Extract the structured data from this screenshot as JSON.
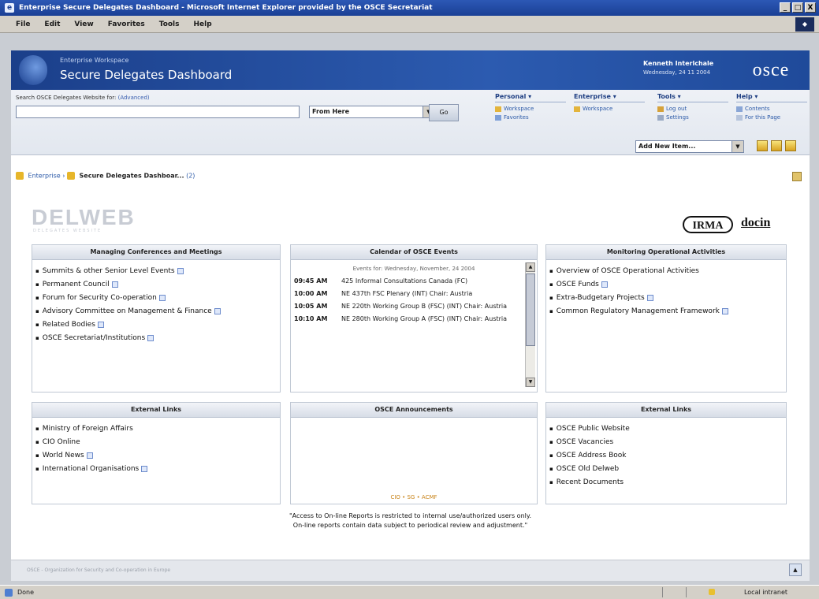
{
  "window": {
    "title": "Enterprise Secure Delegates Dashboard - Microsoft Internet Explorer provided by the OSCE Secretariat",
    "buttons": [
      "_",
      "□",
      "X"
    ]
  },
  "menubar": [
    "File",
    "Edit",
    "View",
    "Favorites",
    "Tools",
    "Help"
  ],
  "banner": {
    "subtitle": "Enterprise Workspace",
    "title": "Secure Delegates Dashboard",
    "user": "Kenneth Interlchale",
    "date": "Wednesday, 24 11 2004",
    "logo": "osce"
  },
  "search": {
    "label": "Search OSCE Delegates Website for:",
    "advanced": "(Advanced)",
    "value": "",
    "scope": "From Here",
    "go": "Go"
  },
  "nav": [
    {
      "heading": "Personal ▾",
      "links": [
        "Workspace",
        "Favorites"
      ]
    },
    {
      "heading": "Enterprise ▾",
      "links": [
        "Workspace"
      ]
    },
    {
      "heading": "Tools ▾",
      "links": [
        "Log out",
        "Settings"
      ]
    },
    {
      "heading": "Help ▾",
      "links": [
        "Contents",
        "For this Page"
      ]
    }
  ],
  "add_new": "Add New Item...",
  "breadcrumb": {
    "root": "Enterprise",
    "current": "Secure Delegates Dashboar...",
    "suffix": "(2)"
  },
  "logos": {
    "delweb": "DELWEB",
    "delweb_sub": "DELEGATES WEBSITE",
    "irma": "IRMA",
    "docin": "docin"
  },
  "panels": {
    "conferences": {
      "header": "Managing Conferences and Meetings",
      "items": [
        "Summits & other Senior Level Events",
        "Permanent Council",
        "Forum for Security Co-operation",
        "Advisory Committee on Management & Finance",
        "Related Bodies",
        "OSCE Secretariat/Institutions"
      ]
    },
    "calendar": {
      "header": "Calendar of OSCE Events",
      "caption": "Events for: Wednesday, November, 24 2004",
      "events": [
        {
          "time": "09:45 AM",
          "desc": "425 Informal Consultations Canada (FC)"
        },
        {
          "time": "10:00 AM",
          "desc": "NE 437th FSC Plenary (INT) Chair: Austria"
        },
        {
          "time": "10:05 AM",
          "desc": "NE 220th Working Group B (FSC) (INT) Chair: Austria"
        },
        {
          "time": "10:10 AM",
          "desc": "NE 280th Working Group A (FSC) (INT) Chair: Austria"
        }
      ]
    },
    "operational": {
      "header": "Monitoring Operational Activities",
      "items": [
        "Overview of OSCE Operational Activities",
        "OSCE Funds",
        "Extra-Budgetary Projects",
        "Common Regulatory Management Framework"
      ]
    },
    "external_left": {
      "header": "External Links",
      "items": [
        "Ministry of Foreign Affairs",
        "CIO Online",
        "World News",
        "International Organisations"
      ]
    },
    "announcements": {
      "header": "OSCE Announcements",
      "footer": "CIO • SG • ACMF"
    },
    "external_right": {
      "header": "External Links",
      "items": [
        "OSCE Public Website",
        "OSCE Vacancies",
        "OSCE Address Book",
        "OSCE Old Delweb",
        "Recent Documents"
      ]
    }
  },
  "disclaimer": {
    "line1": "\"Access to On-line Reports is restricted to internal use/authorized users only.",
    "line2": "On-line reports contain data subject to periodical review and adjustment.\""
  },
  "footer": "OSCE - Organization for Security and Co-operation in Europe",
  "status": {
    "text": "Done",
    "zone": "Local intranet"
  }
}
